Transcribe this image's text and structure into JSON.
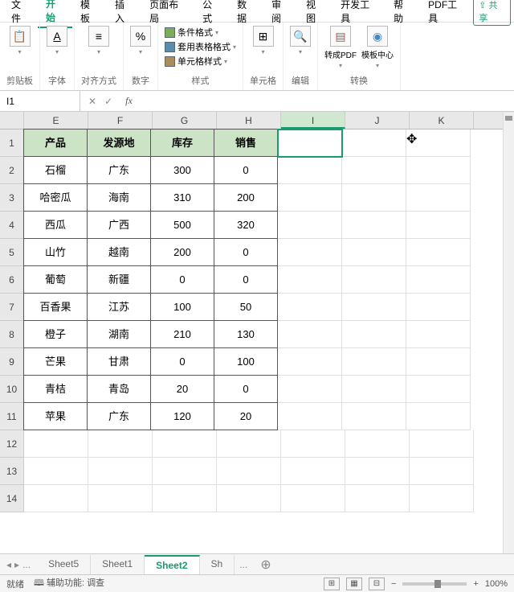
{
  "menu": {
    "items": [
      "文件",
      "开始",
      "模板",
      "插入",
      "页面布局",
      "公式",
      "数据",
      "审阅",
      "视图",
      "开发工具",
      "帮助",
      "PDF工具"
    ],
    "active": 1,
    "share": "共享"
  },
  "ribbon": {
    "g1": {
      "label": "剪贴板",
      "btn": "📋"
    },
    "g2": {
      "label": "字体",
      "btn": "A"
    },
    "g3": {
      "label": "对齐方式",
      "btn": "≡"
    },
    "g4": {
      "label": "数字",
      "btn": "%"
    },
    "g5": {
      "label": "样式",
      "items": [
        "条件格式",
        "套用表格格式",
        "单元格样式"
      ]
    },
    "g6": {
      "label": "单元格",
      "btn": "⊞"
    },
    "g7": {
      "label": "编辑",
      "btn": "🔍"
    },
    "g8": {
      "label": "转换",
      "btn1": "转成PDF",
      "btn2": "模板中心"
    }
  },
  "formula": {
    "name": "I1",
    "fx": "fx"
  },
  "cols": [
    "E",
    "F",
    "G",
    "H",
    "I",
    "J",
    "K"
  ],
  "selected_col": 4,
  "headers": [
    "产品",
    "发源地",
    "库存",
    "销售"
  ],
  "chart_data": {
    "type": "table",
    "columns": [
      "产品",
      "发源地",
      "库存",
      "销售"
    ],
    "rows": [
      [
        "石榴",
        "广东",
        300,
        0
      ],
      [
        "哈密瓜",
        "海南",
        310,
        200
      ],
      [
        "西瓜",
        "广西",
        500,
        320
      ],
      [
        "山竹",
        "越南",
        200,
        0
      ],
      [
        "葡萄",
        "新疆",
        0,
        0
      ],
      [
        "百香果",
        "江苏",
        100,
        50
      ],
      [
        "橙子",
        "湖南",
        210,
        130
      ],
      [
        "芒果",
        "甘肃",
        0,
        100
      ],
      [
        "青桔",
        "青岛",
        20,
        0
      ],
      [
        "苹果",
        "广东",
        120,
        20
      ]
    ]
  },
  "extra_rows": [
    12,
    13,
    14
  ],
  "sheets": {
    "list": [
      "Sheet5",
      "Sheet1",
      "Sheet2",
      "Sh"
    ],
    "active": 2,
    "ellipsis": "...",
    "more": "..."
  },
  "status": {
    "ready": "就绪",
    "access": "辅助功能: 调查",
    "zoom": "100%"
  }
}
